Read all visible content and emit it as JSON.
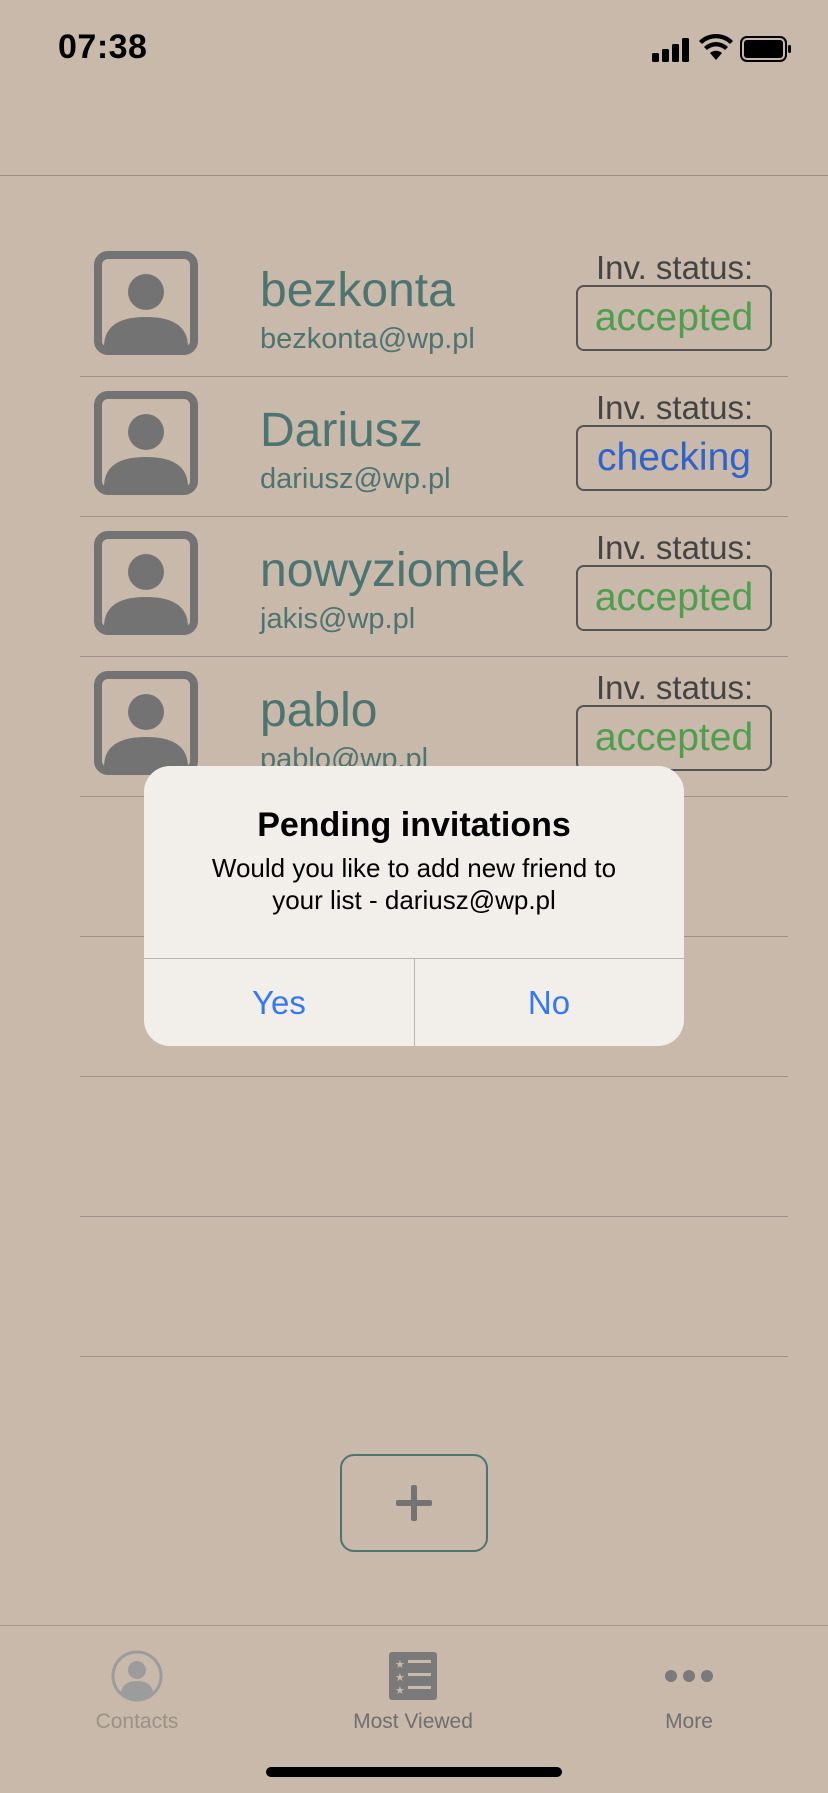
{
  "status_bar": {
    "time": "07:38"
  },
  "contacts": [
    {
      "name": "bezkonta",
      "email": "bezkonta@wp.pl",
      "status_label": "Inv. status:",
      "status": "accepted",
      "status_color": "#4e9e4e"
    },
    {
      "name": "Dariusz",
      "email": "dariusz@wp.pl",
      "status_label": "Inv. status:",
      "status": "checking",
      "status_color": "#2f63c9"
    },
    {
      "name": "nowyziomek",
      "email": "jakis@wp.pl",
      "status_label": "Inv. status:",
      "status": "accepted",
      "status_color": "#4e9e4e"
    },
    {
      "name": "pablo",
      "email": "pablo@wp.pl",
      "status_label": "Inv. status:",
      "status": "accepted",
      "status_color": "#4e9e4e"
    }
  ],
  "alert": {
    "title": "Pending invitations",
    "message": "Would you like to add new friend to your list - dariusz@wp.pl",
    "yes_label": "Yes",
    "no_label": "No"
  },
  "tab_bar": {
    "tabs": [
      {
        "label": "Contacts",
        "icon": "person-circle-icon",
        "state": "disabled"
      },
      {
        "label": "Most Viewed",
        "icon": "star-list-icon",
        "state": "normal"
      },
      {
        "label": "More",
        "icon": "more-dots-icon",
        "state": "normal"
      }
    ]
  },
  "colors": {
    "background": "#c9b9ab",
    "accent_text": "#4d7470",
    "accepted": "#4e9e4e",
    "checking": "#2f63c9",
    "alert_button": "#3478f6"
  }
}
